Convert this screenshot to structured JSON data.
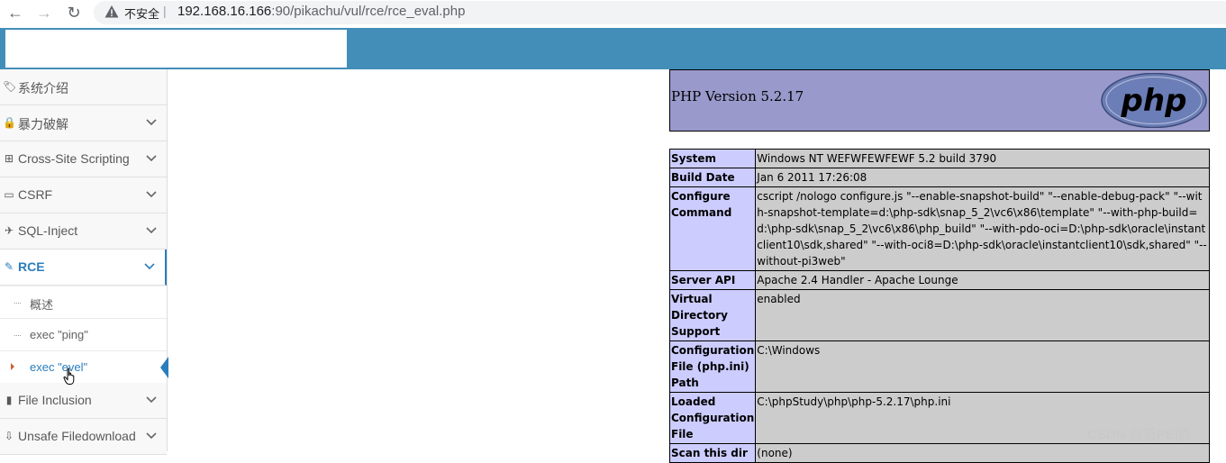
{
  "browser": {
    "back_label": "←",
    "forward_label": "→",
    "reload_label": "↻",
    "security_label": "不安全",
    "separator": "|",
    "url_host": "192.168.16.166",
    "url_rest": ":90/pikachu/vul/rce/rce_eval.php"
  },
  "sidebar": {
    "items": [
      {
        "icon": "tag-icon",
        "glyph": "🏷",
        "label": "系统介绍"
      },
      {
        "icon": "lock-icon",
        "glyph": "🔒",
        "label": "暴力破解"
      },
      {
        "icon": "sitemap-icon",
        "glyph": "⊞",
        "label": "Cross-Site Scripting"
      },
      {
        "icon": "credit-card-icon",
        "glyph": "▭",
        "label": "CSRF"
      },
      {
        "icon": "plane-icon",
        "glyph": "✈",
        "label": "SQL-Inject"
      },
      {
        "icon": "pencil-icon",
        "glyph": "✎",
        "label": "RCE"
      },
      {
        "icon": "file-icon",
        "glyph": "▮",
        "label": "File Inclusion"
      },
      {
        "icon": "download-icon",
        "glyph": "⇩",
        "label": "Unsafe Filedownload"
      }
    ],
    "rce_sub": [
      {
        "label": "概述"
      },
      {
        "label": "exec \"ping\""
      },
      {
        "label": "exec \"evel\""
      }
    ]
  },
  "phpinfo": {
    "version": "PHP Version 5.2.17",
    "logo_text": "php",
    "rows": [
      {
        "key": "System",
        "value": "Windows NT WEFWFEWFEWF 5.2 build 3790"
      },
      {
        "key": "Build Date",
        "value": "Jan 6 2011 17:26:08"
      },
      {
        "key": "Configure Command",
        "value": "cscript /nologo configure.js \"--enable-snapshot-build\" \"--enable-debug-pack\" \"--with-snapshot-template=d:\\php-sdk\\snap_5_2\\vc6\\x86\\template\" \"--with-php-build=d:\\php-sdk\\snap_5_2\\vc6\\x86\\php_build\" \"--with-pdo-oci=D:\\php-sdk\\oracle\\instantclient10\\sdk,shared\" \"--with-oci8=D:\\php-sdk\\oracle\\instantclient10\\sdk,shared\" \"--without-pi3web\""
      },
      {
        "key": "Server API",
        "value": "Apache 2.4 Handler - Apache Lounge"
      },
      {
        "key": "Virtual Directory Support",
        "value": "enabled"
      },
      {
        "key": "Configuration File (php.ini) Path",
        "value": "C:\\Windows"
      },
      {
        "key": "Loaded Configuration File",
        "value": "C:\\phpStudy\\php\\php-5.2.17\\php.ini"
      },
      {
        "key": "Scan this dir",
        "value": "(none)"
      }
    ]
  },
  "watermark": "CSDN @范PEI西",
  "colors": {
    "header_bg": "#438eb9",
    "accent": "#2b7dbc",
    "php_header_bg": "#9999cc",
    "php_key_bg": "#ccccff",
    "php_value_bg": "#cccccc"
  }
}
